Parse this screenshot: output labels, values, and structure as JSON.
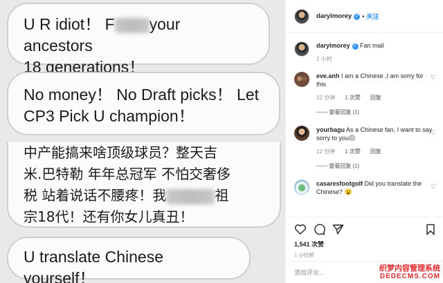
{
  "image": {
    "bubbles": [
      {
        "line1_pre": "U R idiot！ F",
        "line1_post": "your ancestors",
        "line2": "18 generations！"
      },
      {
        "line1": "No money！ No Draft picks！ Let",
        "line2": "CP3 Pick U champion！"
      },
      {
        "line1": "中产能搞来啥顶级球员？整天吉",
        "line2": "米.巴特勒 年年总冠军 不怕交奢侈",
        "line3_pre": "税 站着说话不腰疼！我",
        "line3_post": "祖",
        "line4": "宗18代！还有你女儿真丑！"
      },
      {
        "line1": "U translate Chinese yourself！"
      }
    ]
  },
  "header": {
    "username": "darylmorey",
    "dot": "•",
    "follow_label": "关注"
  },
  "caption": {
    "username": "darylmorey",
    "text": "Fan mail",
    "time": "1 小时"
  },
  "comments": [
    {
      "username": "eve.anh",
      "text": "I am a Chinese ,I am sorry for this",
      "time": "12 分钟",
      "likes": "1 次赞",
      "reply": "回复",
      "view_replies": "—— 查看回复 (1)"
    },
    {
      "username": "yourbagu",
      "text": "As a Chinese fan, I want to say sorry to you☹",
      "time": "12 分钟",
      "likes": "1 次赞",
      "reply": "回复",
      "view_replies": "—— 查看回复 (1)"
    },
    {
      "username": "casaresfootgolf",
      "text": "Did you translate the Chinese? 😮",
      "time": "",
      "likes": "",
      "reply": "",
      "view_replies": ""
    }
  ],
  "actions": {
    "likes": "1,541 次赞",
    "time": "1 小时前",
    "add_comment_placeholder": "添加评论..."
  },
  "watermark": {
    "line1": "织梦内容管理系统",
    "line2": "DEDECMS.COM"
  },
  "colors": {
    "accent": "#3897f0",
    "muted": "#8e8e8e",
    "watermark": "#e3262b"
  }
}
